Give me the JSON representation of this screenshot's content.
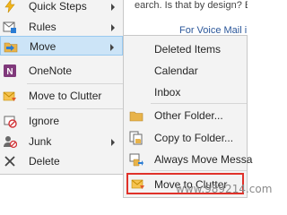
{
  "background": {
    "text": "earch. Is that by design? Be",
    "link": "For Voice Mail in Outlook"
  },
  "main_menu": {
    "items": [
      {
        "label": "Quick Steps",
        "icon": "quick-steps-icon",
        "submenu": true
      },
      {
        "label": "Rules",
        "icon": "rules-icon",
        "submenu": true
      },
      {
        "label": "Move",
        "icon": "move-folder-icon",
        "submenu": true,
        "highlighted": true
      },
      {
        "label": "OneNote",
        "icon": "onenote-icon",
        "submenu": false
      },
      {
        "label": "Move to Clutter",
        "icon": "clutter-icon",
        "submenu": false
      },
      {
        "label": "Ignore",
        "icon": "ignore-icon",
        "submenu": false
      },
      {
        "label": "Junk",
        "icon": "junk-icon",
        "submenu": true
      },
      {
        "label": "Delete",
        "icon": "delete-icon",
        "submenu": false
      }
    ]
  },
  "move_submenu": {
    "items": [
      {
        "label": "Deleted Items",
        "icon": ""
      },
      {
        "label": "Calendar",
        "icon": ""
      },
      {
        "label": "Inbox",
        "icon": ""
      },
      {
        "label": "Other Folder...",
        "icon": "folder-icon"
      },
      {
        "label": "Copy to Folder...",
        "icon": "copy-folder-icon"
      },
      {
        "label": "Always Move Messa",
        "icon": "always-move-icon"
      },
      {
        "label": "Move to Clutter",
        "icon": "clutter-icon",
        "highlighted_box": true
      }
    ]
  },
  "watermark": "www.989214.com",
  "colors": {
    "menu_bg": "#f3f3f3",
    "highlight_bg": "#cce4f7",
    "annotation_box": "#e0322a"
  }
}
